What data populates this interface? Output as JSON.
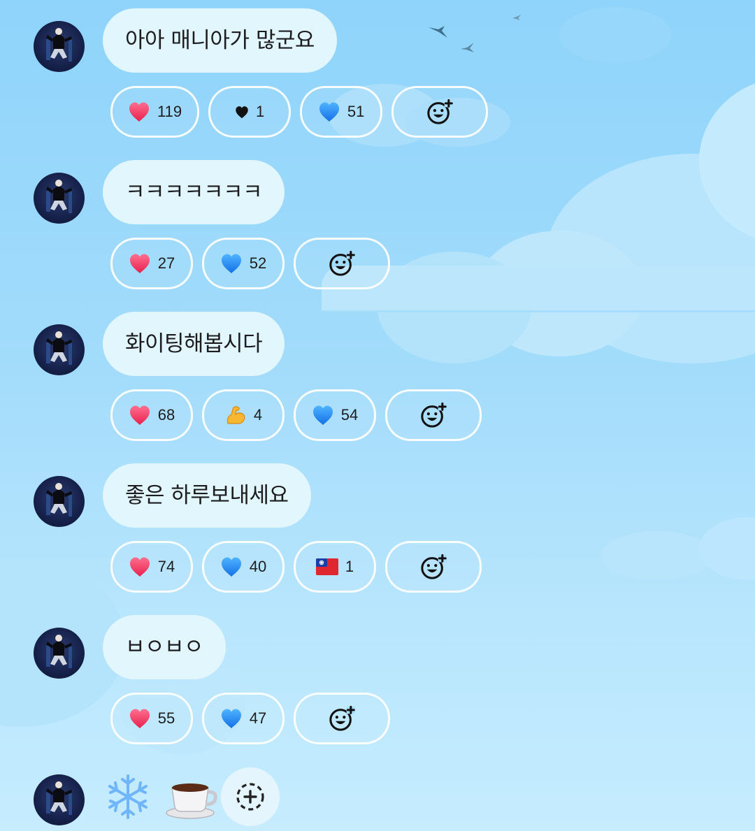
{
  "messages": [
    {
      "text": "아아 매니아가 많군요",
      "reactions": [
        {
          "emoji": "red-heart",
          "count": "119"
        },
        {
          "emoji": "black-heart",
          "count": "1"
        },
        {
          "emoji": "blue-heart",
          "count": "51"
        }
      ]
    },
    {
      "text": "ㅋㅋㅋㅋㅋㅋㅋ",
      "reactions": [
        {
          "emoji": "red-heart",
          "count": "27"
        },
        {
          "emoji": "blue-heart",
          "count": "52"
        }
      ]
    },
    {
      "text": "화이팅해봅시다",
      "reactions": [
        {
          "emoji": "red-heart",
          "count": "68"
        },
        {
          "emoji": "flexed-biceps",
          "count": "4"
        },
        {
          "emoji": "blue-heart",
          "count": "54"
        }
      ]
    },
    {
      "text": "좋은 하루보내세요",
      "reactions": [
        {
          "emoji": "red-heart",
          "count": "74"
        },
        {
          "emoji": "blue-heart",
          "count": "40"
        },
        {
          "emoji": "taiwan-flag",
          "count": "1"
        }
      ]
    },
    {
      "text": "ㅂㅇㅂㅇ",
      "reactions": [
        {
          "emoji": "red-heart",
          "count": "55"
        },
        {
          "emoji": "blue-heart",
          "count": "47"
        }
      ]
    }
  ],
  "last_message": {
    "emojis": [
      "❄️",
      "☕"
    ]
  },
  "colors": {
    "bubble_bg": "#e2f6fe",
    "text": "#1d1d1f",
    "sky_top": "#8fd4fb",
    "sky_bottom": "#c6ecfe"
  }
}
